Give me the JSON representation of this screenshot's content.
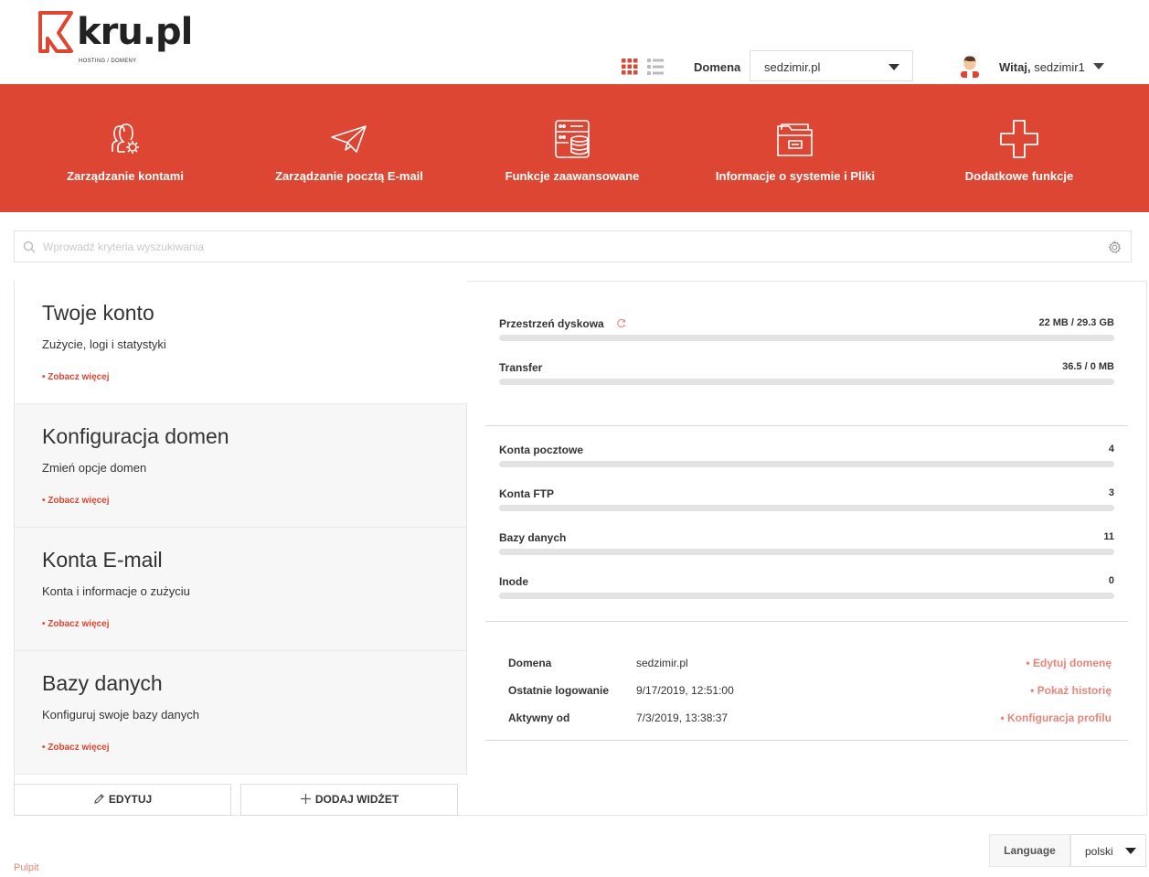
{
  "header": {
    "logo_text": "kru.pl",
    "logo_sub": "HOSTING / DOMENY",
    "domain_label": "Domena",
    "domain_value": "sedzimir.pl",
    "greeting_prefix": "Witaj,",
    "username": "sedzimir1"
  },
  "nav": [
    {
      "label": "Zarządzanie kontami",
      "icon": "users-gear-icon"
    },
    {
      "label": "Zarządzanie pocztą E-mail",
      "icon": "paper-plane-icon"
    },
    {
      "label": "Funkcje zaawansowane",
      "icon": "server-database-icon"
    },
    {
      "label": "Informacje o systemie i Pliki",
      "icon": "folder-icon"
    },
    {
      "label": "Dodatkowe funkcje",
      "icon": "plus-icon"
    }
  ],
  "search": {
    "placeholder": "Wprowadź kryteria wyszukiwania"
  },
  "cards": [
    {
      "title": "Twoje konto",
      "subtitle": "Zużycie, logi i statystyki",
      "more": "• Zobacz więcej"
    },
    {
      "title": "Konfiguracja domen",
      "subtitle": "Zmień opcje domen",
      "more": "• Zobacz więcej"
    },
    {
      "title": "Konta E-mail",
      "subtitle": "Konta i informacje o zużyciu",
      "more": "• Zobacz więcej"
    },
    {
      "title": "Bazy danych",
      "subtitle": "Konfiguruj swoje bazy danych",
      "more": "• Zobacz więcej"
    }
  ],
  "buttons": {
    "edit": "EDYTUJ",
    "add_widget": "DODAJ WIDŻET"
  },
  "usage": [
    {
      "label": "Przestrzeń dyskowa",
      "value": "22 MB / 29.3 GB",
      "fill_percent": 0
    },
    {
      "label": "Transfer",
      "value": "36.5 / 0 MB",
      "fill_percent": 0
    }
  ],
  "counts": [
    {
      "label": "Konta pocztowe",
      "value": "4"
    },
    {
      "label": "Konta FTP",
      "value": "3"
    },
    {
      "label": "Bazy danych",
      "value": "11"
    },
    {
      "label": "Inode",
      "value": "0"
    }
  ],
  "info": [
    {
      "label": "Domena",
      "value": "sedzimir.pl",
      "link": "• Edytuj domenę"
    },
    {
      "label": "Ostatnie logowanie",
      "value": "9/17/2019, 12:51:00",
      "link": "• Pokaż historię"
    },
    {
      "label": "Aktywny od",
      "value": "7/3/2019, 13:38:37",
      "link": "• Konfiguracja profilu"
    }
  ],
  "footer": {
    "language_label": "Language",
    "language_value": "polski",
    "breadcrumb": "Pulpit"
  },
  "colors": {
    "accent": "#dd4632",
    "link": "#e8857a"
  }
}
